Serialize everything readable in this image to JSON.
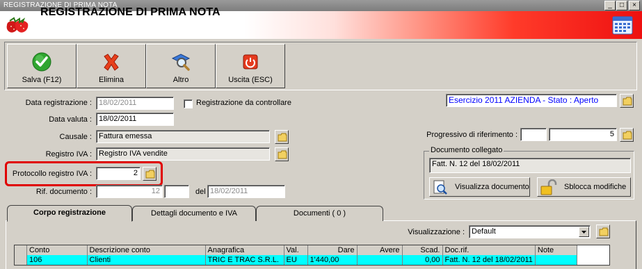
{
  "window": {
    "title": "REGISTRAZIONE DI PRIMA NOTA",
    "min": "_",
    "max": "□",
    "close": "×"
  },
  "header": {
    "title": "REGISTRAZIONE DI PRIMA NOTA"
  },
  "toolbar": {
    "save": "Salva (F12)",
    "delete": "Elimina",
    "other": "Altro",
    "exit": "Uscita (ESC)"
  },
  "form": {
    "data_registrazione_label": "Data registrazione :",
    "data_registrazione": "18/02/2011",
    "da_controllare_label": "Registrazione da controllare",
    "data_valuta_label": "Data valuta :",
    "data_valuta": "18/02/2011",
    "causale_label": "Causale :",
    "causale": "Fattura emessa",
    "registro_iva_label": "Registro IVA :",
    "registro_iva": "Registro IVA vendite",
    "protocollo_label": "Protocollo registro IVA :",
    "protocollo": "2",
    "rif_doc_label": "Rif. documento :",
    "rif_doc_num": "12",
    "rif_doc_suffix": "",
    "del_label": "del",
    "rif_doc_date": "18/02/2011"
  },
  "right": {
    "esercizio": "Esercizio 2011 AZIENDA - Stato : Aperto",
    "progressivo_label": "Progressivo di riferimento :",
    "progressivo_a": "",
    "progressivo_b": "5",
    "doc_collegato_label": "Documento collegato",
    "doc_collegato": "Fatt. N. 12 del 18/02/2011",
    "visualizza_btn": "Visualizza documento",
    "sblocca_btn": "Sblocca modifiche"
  },
  "tabs": [
    "Corpo registrazione",
    "Dettagli documento e IVA",
    "Documenti ( 0 )"
  ],
  "view": {
    "label": "Visualizzazione :",
    "value": "Default"
  },
  "grid": {
    "columns": [
      "Conto",
      "Descrizione conto",
      "Anagrafica",
      "Val.",
      "Dare",
      "Avere",
      "Scad.",
      "Doc.rif.",
      "Note"
    ],
    "rows": [
      [
        "106",
        "Clienti",
        "TRIC E TRAC S.R.L.",
        "EU",
        "1'440,00",
        "",
        "0,00",
        "Fatt. N. 12 del 18/02/2011",
        ""
      ]
    ]
  },
  "colors": {
    "highlight_border": "#e00000",
    "selected_row": "#00ffff",
    "esercizio_text": "#0000ff"
  }
}
